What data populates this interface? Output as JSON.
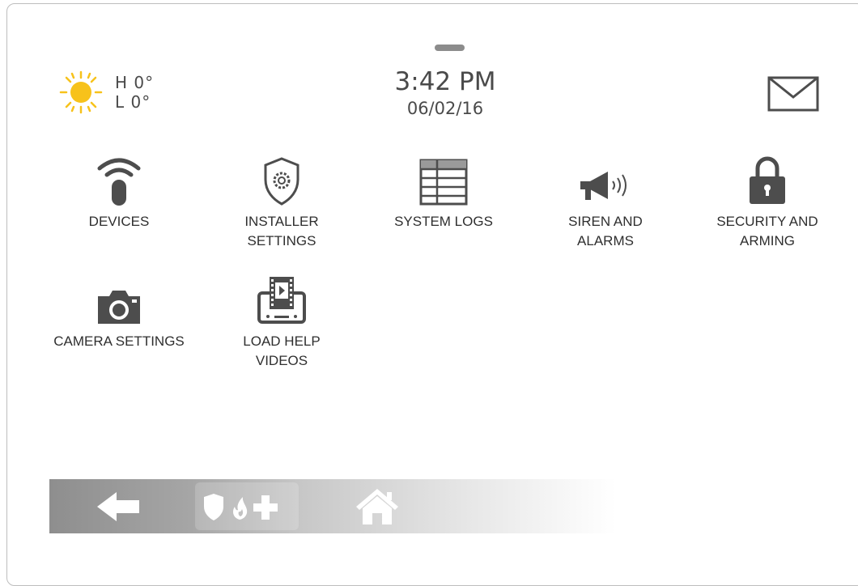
{
  "status": {
    "weather": {
      "high_label": "H 0°",
      "low_label": "L 0°",
      "icon": "sun-icon"
    },
    "time": "3:42 PM",
    "date": "06/02/16",
    "messages_icon": "envelope-icon"
  },
  "menu": {
    "items": [
      {
        "label": "DEVICES",
        "icon": "wireless-fob-icon"
      },
      {
        "label": "INSTALLER\nSETTINGS",
        "icon": "shield-gear-icon"
      },
      {
        "label": "SYSTEM LOGS",
        "icon": "table-log-icon"
      },
      {
        "label": "SIREN AND\nALARMS",
        "icon": "megaphone-icon"
      },
      {
        "label": "SECURITY AND\nARMING",
        "icon": "padlock-icon"
      },
      {
        "label": "CAMERA SETTINGS",
        "icon": "camera-icon"
      },
      {
        "label": "LOAD HELP\nVIDEOS",
        "icon": "video-tablet-icon"
      }
    ]
  },
  "navbar": {
    "back_icon": "back-arrow-icon",
    "emergency_icons": [
      "shield-icon",
      "flame-icon",
      "plus-icon"
    ],
    "home_icon": "home-icon"
  },
  "colors": {
    "icon_gray": "#4d4d4d",
    "sun_yellow": "#f7c21b",
    "nav_gray": "#8e8e8e"
  }
}
